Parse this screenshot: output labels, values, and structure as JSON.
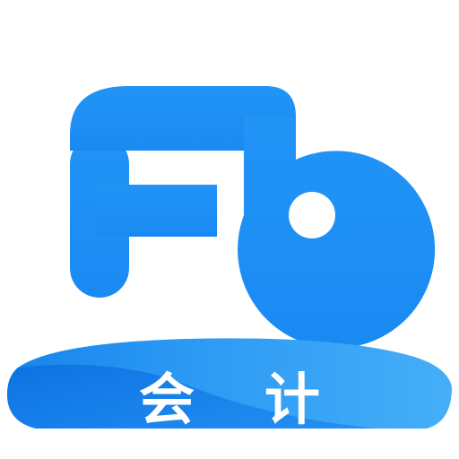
{
  "app_icon": {
    "logo_name": "fb-logo",
    "caption_chars": [
      "会",
      "计"
    ]
  },
  "colors": {
    "background": "#FFFFFF",
    "logo_blue": "#1E8FF5",
    "banner_light": "#3AA6F6",
    "banner_dark": "#0E75E6",
    "caption_text": "#FFFFFF"
  }
}
